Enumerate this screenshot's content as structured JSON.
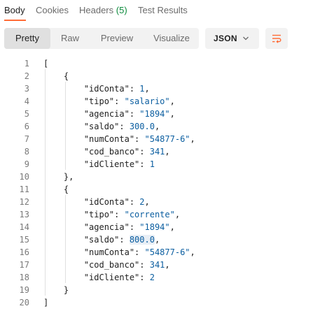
{
  "response_tabs": [
    {
      "label": "Body",
      "active": true
    },
    {
      "label": "Cookies",
      "active": false
    },
    {
      "label": "Headers",
      "count": "(5)",
      "active": false
    },
    {
      "label": "Test Results",
      "active": false
    }
  ],
  "view_modes": [
    {
      "label": "Pretty",
      "active": true
    },
    {
      "label": "Raw",
      "active": false
    },
    {
      "label": "Preview",
      "active": false
    },
    {
      "label": "Visualize",
      "active": false
    }
  ],
  "format": {
    "selected": "JSON"
  },
  "icons": {
    "format_dropdown": "chevron-down-icon",
    "wrap": "wrap-lines-icon"
  },
  "colors": {
    "accent": "#ff6c37",
    "count": "#0c8a3c",
    "value": "#0b5ea0"
  },
  "highlighted_value": "800.0",
  "body_lines": [
    {
      "n": "1",
      "indent": "",
      "tokens": [
        {
          "t": "[",
          "c": "punct"
        }
      ]
    },
    {
      "n": "2",
      "indent": "    ",
      "tokens": [
        {
          "t": "{",
          "c": "punct"
        }
      ]
    },
    {
      "n": "3",
      "indent": "        ",
      "tokens": [
        {
          "t": "\"idConta\"",
          "c": "key"
        },
        {
          "t": ": ",
          "c": "punct"
        },
        {
          "t": "1",
          "c": "num"
        },
        {
          "t": ",",
          "c": "punct"
        }
      ]
    },
    {
      "n": "4",
      "indent": "        ",
      "tokens": [
        {
          "t": "\"tipo\"",
          "c": "key"
        },
        {
          "t": ": ",
          "c": "punct"
        },
        {
          "t": "\"salario\"",
          "c": "str"
        },
        {
          "t": ",",
          "c": "punct"
        }
      ]
    },
    {
      "n": "5",
      "indent": "        ",
      "tokens": [
        {
          "t": "\"agencia\"",
          "c": "key"
        },
        {
          "t": ": ",
          "c": "punct"
        },
        {
          "t": "\"1894\"",
          "c": "str"
        },
        {
          "t": ",",
          "c": "punct"
        }
      ]
    },
    {
      "n": "6",
      "indent": "        ",
      "tokens": [
        {
          "t": "\"saldo\"",
          "c": "key"
        },
        {
          "t": ": ",
          "c": "punct"
        },
        {
          "t": "300.0",
          "c": "num"
        },
        {
          "t": ",",
          "c": "punct"
        }
      ]
    },
    {
      "n": "7",
      "indent": "        ",
      "tokens": [
        {
          "t": "\"numConta\"",
          "c": "key"
        },
        {
          "t": ": ",
          "c": "punct"
        },
        {
          "t": "\"54877-6\"",
          "c": "str"
        },
        {
          "t": ",",
          "c": "punct"
        }
      ]
    },
    {
      "n": "8",
      "indent": "        ",
      "tokens": [
        {
          "t": "\"cod_banco\"",
          "c": "key"
        },
        {
          "t": ": ",
          "c": "punct"
        },
        {
          "t": "341",
          "c": "num"
        },
        {
          "t": ",",
          "c": "punct"
        }
      ]
    },
    {
      "n": "9",
      "indent": "        ",
      "tokens": [
        {
          "t": "\"idCliente\"",
          "c": "key"
        },
        {
          "t": ": ",
          "c": "punct"
        },
        {
          "t": "1",
          "c": "num"
        }
      ]
    },
    {
      "n": "10",
      "indent": "    ",
      "tokens": [
        {
          "t": "},",
          "c": "punct"
        }
      ]
    },
    {
      "n": "11",
      "indent": "    ",
      "tokens": [
        {
          "t": "{",
          "c": "punct"
        }
      ]
    },
    {
      "n": "12",
      "indent": "        ",
      "tokens": [
        {
          "t": "\"idConta\"",
          "c": "key"
        },
        {
          "t": ": ",
          "c": "punct"
        },
        {
          "t": "2",
          "c": "num"
        },
        {
          "t": ",",
          "c": "punct"
        }
      ]
    },
    {
      "n": "13",
      "indent": "        ",
      "tokens": [
        {
          "t": "\"tipo\"",
          "c": "key"
        },
        {
          "t": ": ",
          "c": "punct"
        },
        {
          "t": "\"corrente\"",
          "c": "str"
        },
        {
          "t": ",",
          "c": "punct"
        }
      ]
    },
    {
      "n": "14",
      "indent": "        ",
      "tokens": [
        {
          "t": "\"agencia\"",
          "c": "key"
        },
        {
          "t": ": ",
          "c": "punct"
        },
        {
          "t": "\"1894\"",
          "c": "str"
        },
        {
          "t": ",",
          "c": "punct"
        }
      ]
    },
    {
      "n": "15",
      "indent": "        ",
      "tokens": [
        {
          "t": "\"saldo\"",
          "c": "key"
        },
        {
          "t": ": ",
          "c": "punct"
        },
        {
          "t": "800.0",
          "c": "num",
          "hl": true
        },
        {
          "t": ",",
          "c": "punct"
        }
      ]
    },
    {
      "n": "16",
      "indent": "        ",
      "tokens": [
        {
          "t": "\"numConta\"",
          "c": "key"
        },
        {
          "t": ": ",
          "c": "punct"
        },
        {
          "t": "\"54877-6\"",
          "c": "str"
        },
        {
          "t": ",",
          "c": "punct"
        }
      ]
    },
    {
      "n": "17",
      "indent": "        ",
      "tokens": [
        {
          "t": "\"cod_banco\"",
          "c": "key"
        },
        {
          "t": ": ",
          "c": "punct"
        },
        {
          "t": "341",
          "c": "num"
        },
        {
          "t": ",",
          "c": "punct"
        }
      ]
    },
    {
      "n": "18",
      "indent": "        ",
      "tokens": [
        {
          "t": "\"idCliente\"",
          "c": "key"
        },
        {
          "t": ": ",
          "c": "punct"
        },
        {
          "t": "2",
          "c": "num"
        }
      ]
    },
    {
      "n": "19",
      "indent": "    ",
      "tokens": [
        {
          "t": "}",
          "c": "punct"
        }
      ]
    },
    {
      "n": "20",
      "indent": "",
      "tokens": [
        {
          "t": "]",
          "c": "punct"
        }
      ]
    }
  ]
}
